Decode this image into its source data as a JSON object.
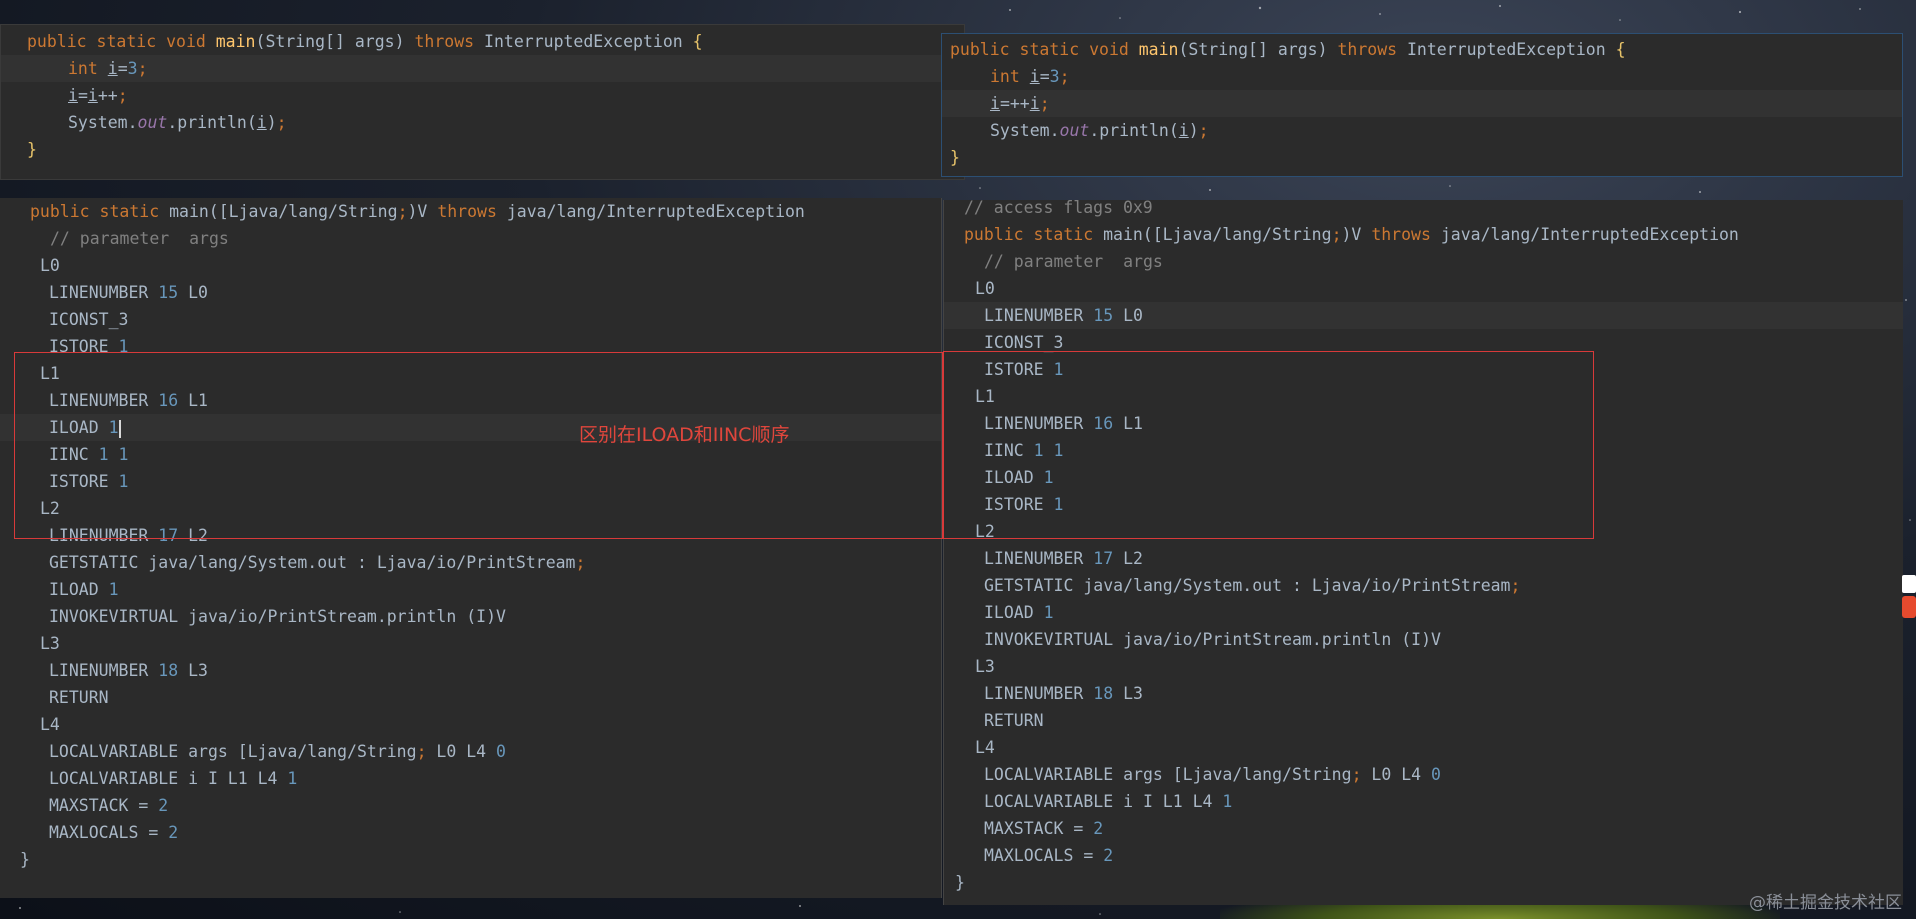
{
  "src_left": {
    "lines": [
      [
        "public static void ",
        "main",
        "(",
        "String",
        "[] ",
        "args",
        ") ",
        "throws ",
        "InterruptedException ",
        "{"
      ],
      "int i=3;",
      "i=i++;",
      "System.out.println(i);",
      "}"
    ]
  },
  "src_right": {
    "lines": [
      "public static void main(String[] args) throws InterruptedException {",
      "int i=3;",
      "i=++i;",
      "System.out.println(i);",
      "}"
    ]
  },
  "bytecode_left": {
    "signature": "public static main([Ljava/lang/String;)V throws java/lang/InterruptedException",
    "param_comment": "// parameter  args",
    "lines": [
      {
        "text": "L0",
        "indent": 1
      },
      {
        "text": "LINENUMBER 15 L0",
        "indent": 2
      },
      {
        "text": "ICONST_3",
        "indent": 2
      },
      {
        "text": "ISTORE 1",
        "indent": 2
      },
      {
        "text": "L1",
        "indent": 1
      },
      {
        "text": "LINENUMBER 16 L1",
        "indent": 2
      },
      {
        "text": "ILOAD 1",
        "indent": 2
      },
      {
        "text": "IINC 1 1",
        "indent": 2
      },
      {
        "text": "ISTORE 1",
        "indent": 2
      },
      {
        "text": "L2",
        "indent": 1
      },
      {
        "text": "LINENUMBER 17 L2",
        "indent": 2
      },
      {
        "text": "GETSTATIC java/lang/System.out : Ljava/io/PrintStream;",
        "indent": 2
      },
      {
        "text": "ILOAD 1",
        "indent": 2
      },
      {
        "text": "INVOKEVIRTUAL java/io/PrintStream.println (I)V",
        "indent": 2
      },
      {
        "text": "L3",
        "indent": 1
      },
      {
        "text": "LINENUMBER 18 L3",
        "indent": 2
      },
      {
        "text": "RETURN",
        "indent": 2
      },
      {
        "text": "L4",
        "indent": 1
      },
      {
        "text": "LOCALVARIABLE args [Ljava/lang/String; L0 L4 0",
        "indent": 2
      },
      {
        "text": "LOCALVARIABLE i I L1 L4 1",
        "indent": 2
      },
      {
        "text": "MAXSTACK = 2",
        "indent": 2
      },
      {
        "text": "MAXLOCALS = 2",
        "indent": 2
      },
      {
        "text": "}",
        "indent": 0
      }
    ]
  },
  "bytecode_right": {
    "access_comment": "// access flags 0x9",
    "signature": "public static main([Ljava/lang/String;)V throws java/lang/InterruptedException",
    "param_comment": "// parameter  args",
    "lines": [
      {
        "text": "L0",
        "indent": 1
      },
      {
        "text": "LINENUMBER 15 L0",
        "indent": 2
      },
      {
        "text": "ICONST_3",
        "indent": 2
      },
      {
        "text": "ISTORE 1",
        "indent": 2
      },
      {
        "text": "L1",
        "indent": 1
      },
      {
        "text": "LINENUMBER 16 L1",
        "indent": 2
      },
      {
        "text": "IINC 1 1",
        "indent": 2
      },
      {
        "text": "ILOAD 1",
        "indent": 2
      },
      {
        "text": "ISTORE 1",
        "indent": 2
      },
      {
        "text": "L2",
        "indent": 1
      },
      {
        "text": "LINENUMBER 17 L2",
        "indent": 2
      },
      {
        "text": "GETSTATIC java/lang/System.out : Ljava/io/PrintStream;",
        "indent": 2
      },
      {
        "text": "ILOAD 1",
        "indent": 2
      },
      {
        "text": "INVOKEVIRTUAL java/io/PrintStream.println (I)V",
        "indent": 2
      },
      {
        "text": "L3",
        "indent": 1
      },
      {
        "text": "LINENUMBER 18 L3",
        "indent": 2
      },
      {
        "text": "RETURN",
        "indent": 2
      },
      {
        "text": "L4",
        "indent": 1
      },
      {
        "text": "LOCALVARIABLE args [Ljava/lang/String; L0 L4 0",
        "indent": 2
      },
      {
        "text": "LOCALVARIABLE i I L1 L4 1",
        "indent": 2
      },
      {
        "text": "MAXSTACK = 2",
        "indent": 2
      },
      {
        "text": "MAXLOCALS = 2",
        "indent": 2
      },
      {
        "text": "}",
        "indent": 0
      }
    ]
  },
  "annotation": {
    "note": "区别在ILOAD和IINC顺序",
    "color": "#d83a3a"
  },
  "watermark": "@稀土掘金技术社区",
  "colors": {
    "keyword": "#cc7832",
    "number": "#6897bb",
    "comment": "#808080",
    "text": "#a9b7c6",
    "editor_bg": "#2b2b2b"
  }
}
